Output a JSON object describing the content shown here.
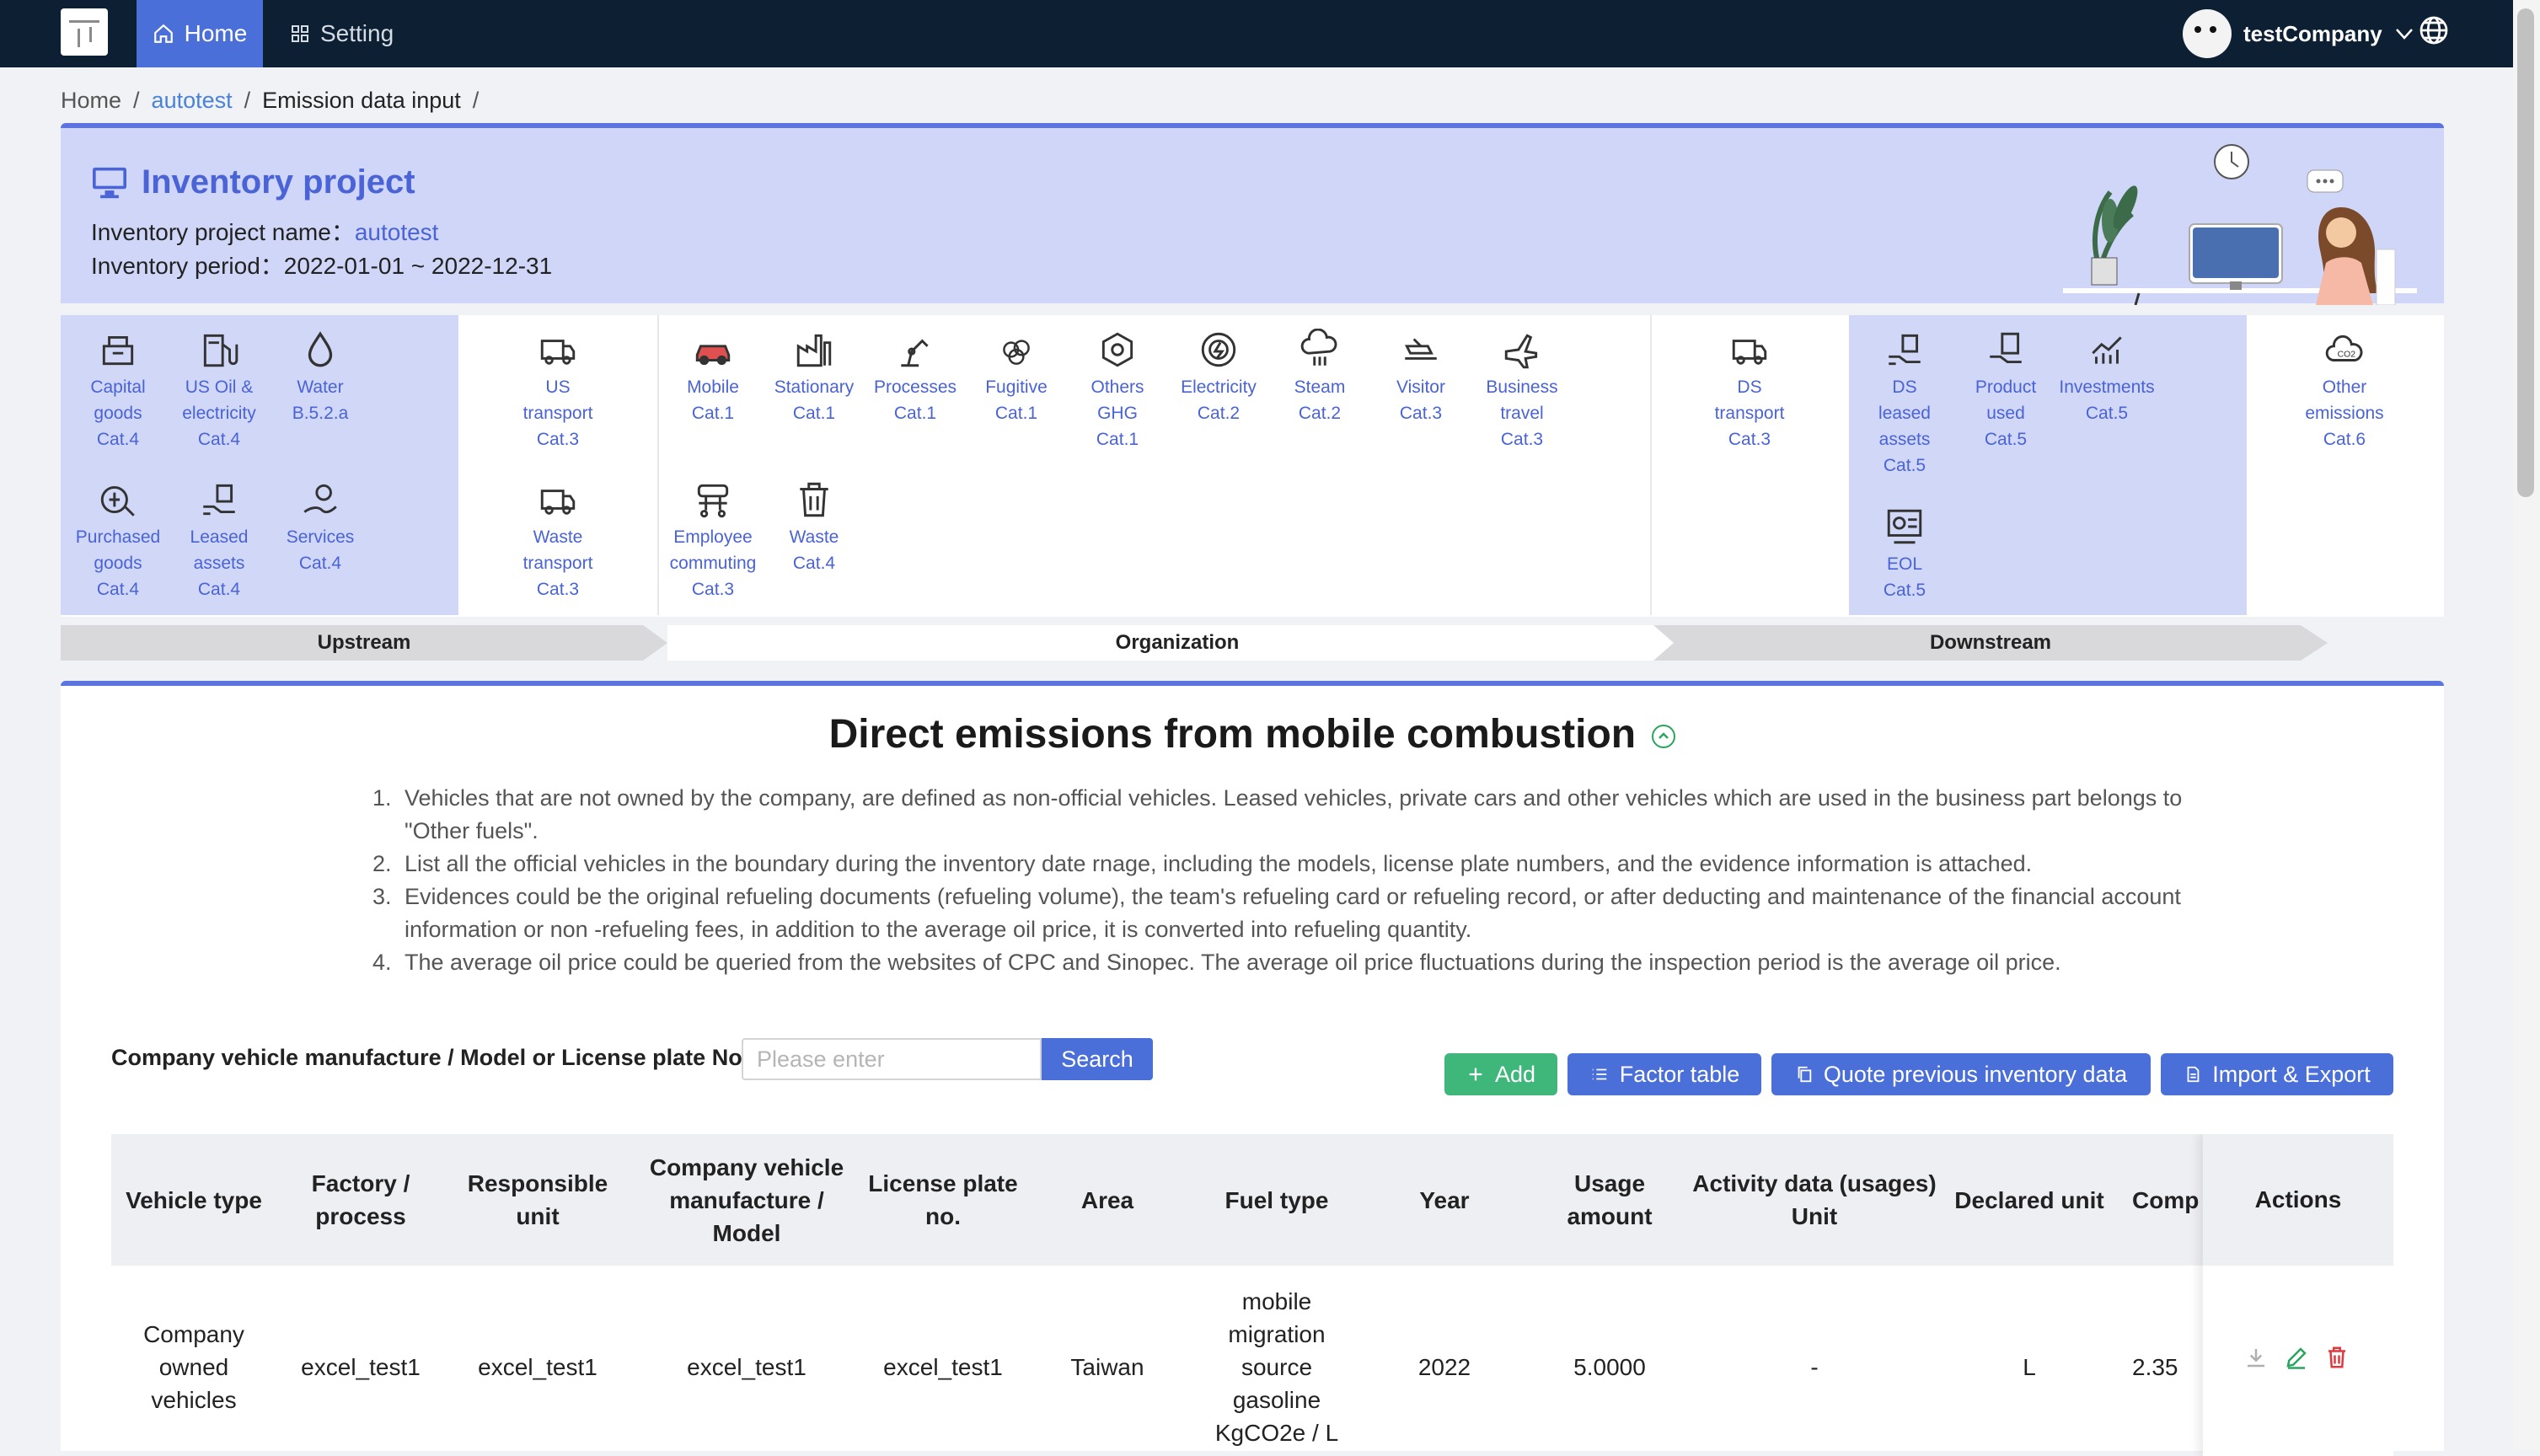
{
  "topbar": {
    "home_label": "Home",
    "setting_label": "Setting",
    "company_name": "testCompany"
  },
  "breadcrumb": [
    "Home",
    "autotest",
    "Emission data input"
  ],
  "project": {
    "title": "Inventory project",
    "name_label": "Inventory project name：",
    "name_value": "autotest",
    "period_label": "Inventory period：",
    "period_value": "2022-01-01 ~ 2022-12-31"
  },
  "categories": {
    "upstream_a": [
      {
        "l1": "Capital",
        "l2": "goods",
        "l3": "Cat.4"
      },
      {
        "l1": "US Oil &",
        "l2": "electricity",
        "l3": "Cat.4"
      },
      {
        "l1": "Water",
        "l2": "B.5.2.a",
        "l3": ""
      },
      {
        "l1": "Purchased",
        "l2": "goods",
        "l3": "Cat.4"
      },
      {
        "l1": "Leased",
        "l2": "assets",
        "l3": "Cat.4"
      },
      {
        "l1": "Services",
        "l2": "Cat.4",
        "l3": ""
      }
    ],
    "upstream_b": [
      {
        "l1": "US",
        "l2": "transport",
        "l3": "Cat.3"
      },
      {
        "l1": "Waste",
        "l2": "transport",
        "l3": "Cat.3"
      }
    ],
    "organization": [
      {
        "l1": "Mobile",
        "l2": "Cat.1",
        "l3": ""
      },
      {
        "l1": "Stationary",
        "l2": "Cat.1",
        "l3": ""
      },
      {
        "l1": "Processes",
        "l2": "Cat.1",
        "l3": ""
      },
      {
        "l1": "Fugitive",
        "l2": "Cat.1",
        "l3": ""
      },
      {
        "l1": "Others",
        "l2": "GHG",
        "l3": "Cat.1"
      },
      {
        "l1": "Electricity",
        "l2": "Cat.2",
        "l3": ""
      },
      {
        "l1": "Steam",
        "l2": "Cat.2",
        "l3": ""
      },
      {
        "l1": "Visitor",
        "l2": "Cat.3",
        "l3": ""
      },
      {
        "l1": "Business",
        "l2": "travel",
        "l3": "Cat.3"
      },
      {
        "l1": "Employee",
        "l2": "commuting",
        "l3": "Cat.3"
      },
      {
        "l1": "Waste",
        "l2": "Cat.4",
        "l3": ""
      }
    ],
    "downstream_a": [
      {
        "l1": "DS",
        "l2": "transport",
        "l3": "Cat.3"
      }
    ],
    "downstream_b": [
      {
        "l1": "DS",
        "l2": "leased",
        "l3": "assets",
        "l4": "Cat.5"
      },
      {
        "l1": "Product",
        "l2": "used",
        "l3": "Cat.5"
      },
      {
        "l1": "Investments",
        "l2": "Cat.5",
        "l3": ""
      },
      {
        "l1": "EOL",
        "l2": "Cat.5",
        "l3": ""
      }
    ],
    "other": [
      {
        "l1": "Other",
        "l2": "emissions",
        "l3": "Cat.6"
      }
    ]
  },
  "stages": {
    "upstream": "Upstream",
    "organization": "Organization",
    "downstream": "Downstream"
  },
  "section": {
    "title": "Direct emissions from mobile combustion",
    "notes": [
      "Vehicles that are not owned by the company, are defined as non-official vehicles. Leased vehicles, private cars and other vehicles which are used in the business part belongs to \"Other fuels\".",
      "List all the official vehicles in the boundary during the inventory date rnage, including the models, license plate numbers, and the evidence information is attached.",
      "Evidences could be the original refueling documents (refueling volume), the team's refueling card or refueling record, or after deducting and maintenance of the financial account information or non -refueling fees, in addition to the average oil price, it is converted into refueling quantity.",
      "The average oil price could be queried from the websites of CPC and Sinopec. The average oil price fluctuations during the inspection period is the average oil price."
    ]
  },
  "search": {
    "label": "Company vehicle manufacture / Model or License plate No.:",
    "placeholder": "Please enter",
    "button": "Search"
  },
  "toolbar": {
    "add": "Add",
    "factor": "Factor table",
    "quote": "Quote previous inventory data",
    "import_export": "Import & Export"
  },
  "table": {
    "headers": [
      "Vehicle type",
      "Factory / process",
      "Responsible unit",
      "Company vehicle manufacture / Model",
      "License plate no.",
      "Area",
      "Fuel type",
      "Year",
      "Usage amount",
      "Activity data (usages) Unit",
      "Declared unit",
      "Comp",
      "Actions"
    ],
    "rows": [
      [
        "Company owned vehicles",
        "excel_test1",
        "excel_test1",
        "excel_test1",
        "excel_test1",
        "Taiwan",
        "mobile migration source gasoline KgCO2e / L",
        "2022",
        "5.0000",
        "-",
        "L",
        "2.35"
      ]
    ]
  },
  "colors": {
    "topbar": "#0d1f33",
    "accent": "#4b6fd8",
    "panel": "#cfd6f7",
    "add": "#3fb77a",
    "delete": "#e0383e"
  }
}
